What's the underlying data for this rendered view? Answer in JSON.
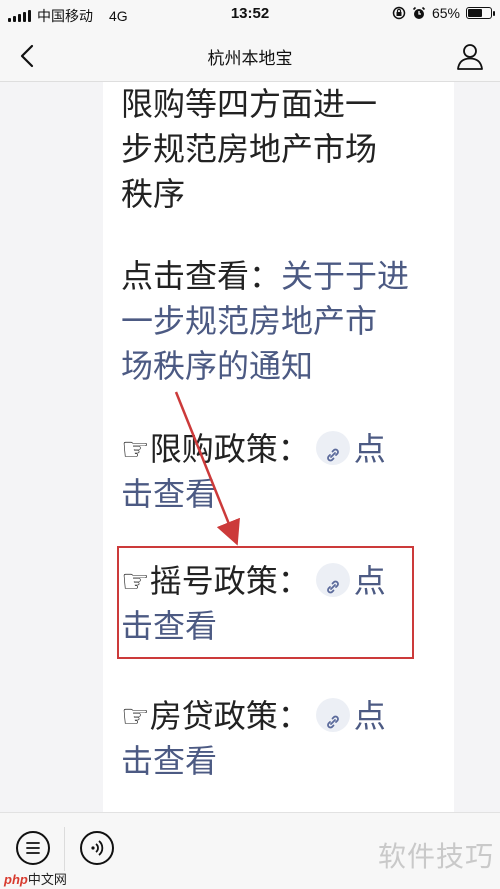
{
  "status_bar": {
    "carrier": "中国移动",
    "network": "4G",
    "time": "13:52",
    "battery_pct": "65%",
    "battery_level": 0.65
  },
  "nav": {
    "title": "杭州本地宝"
  },
  "article": {
    "paragraph1": [
      "限购等四方面进一",
      "步规范房地产市场",
      "秩序"
    ],
    "notice_prefix": "点击查看：",
    "notice_link": [
      "关于于进",
      "一步规范房地产市",
      "场秩序的通知"
    ],
    "policies": [
      {
        "hand": "☞",
        "label": "限购政策：",
        "link_a": "点",
        "link_b": "击查看"
      },
      {
        "hand": "☞",
        "label": "摇号政策：",
        "link_a": "点",
        "link_b": "击查看"
      },
      {
        "hand": "☞",
        "label": "房贷政策：",
        "link_a": "点",
        "link_b": "击查看"
      }
    ]
  },
  "annotation": {
    "highlight_color": "#cc3a3a"
  },
  "bottom_bar": {
    "watermark": "软件技巧",
    "logo_php": "php",
    "logo_cn": "中文网"
  }
}
